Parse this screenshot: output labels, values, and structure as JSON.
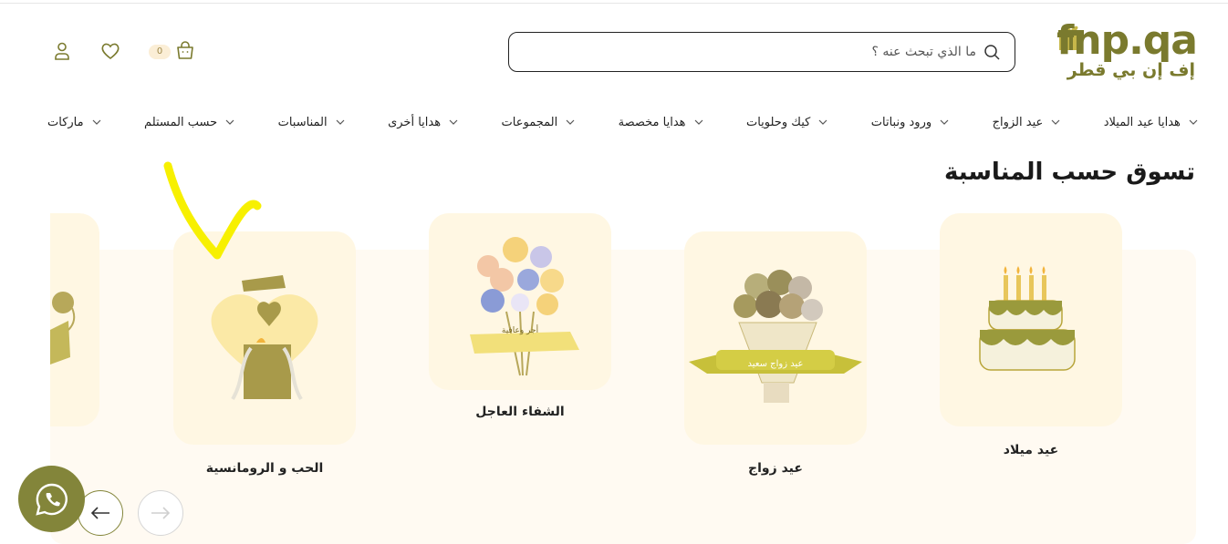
{
  "header": {
    "logo_text": "fnp.qa",
    "logo_ar": "إف إن بي قطر",
    "search_placeholder": "ما الذي تبحث عنه ؟",
    "cart_count": "0"
  },
  "nav": {
    "items": [
      {
        "label": "هدايا عيد الميلاد"
      },
      {
        "label": "عيد الزواج"
      },
      {
        "label": "ورود ونباتات"
      },
      {
        "label": "كيك وحلويات"
      },
      {
        "label": "هدايا مخصصة"
      },
      {
        "label": "المجموعات"
      },
      {
        "label": "هدايا أخرى"
      },
      {
        "label": "المناسبات"
      },
      {
        "label": "حسب المستلم"
      },
      {
        "label": "ماركات"
      }
    ]
  },
  "section": {
    "title": "تسوق حسب المناسبة",
    "cards": [
      {
        "label": "عيد ميلاد",
        "icon": "birthday-cake-icon"
      },
      {
        "label": "عيد زواج",
        "icon": "anniversary-bouquet-icon",
        "ribbon": "عيد زواج سعيد"
      },
      {
        "label": "الشفاء العاجل",
        "icon": "flower-bouquet-icon",
        "ribbon": "أجر وعافية"
      },
      {
        "label": "الحب و الرومانسية",
        "icon": "heart-gift-box-icon"
      }
    ]
  },
  "colors": {
    "brand_olive": "#83853a",
    "card_bg": "#fff7e3",
    "band_bg": "#fffaf2",
    "annotation_yellow": "#f7f000"
  }
}
